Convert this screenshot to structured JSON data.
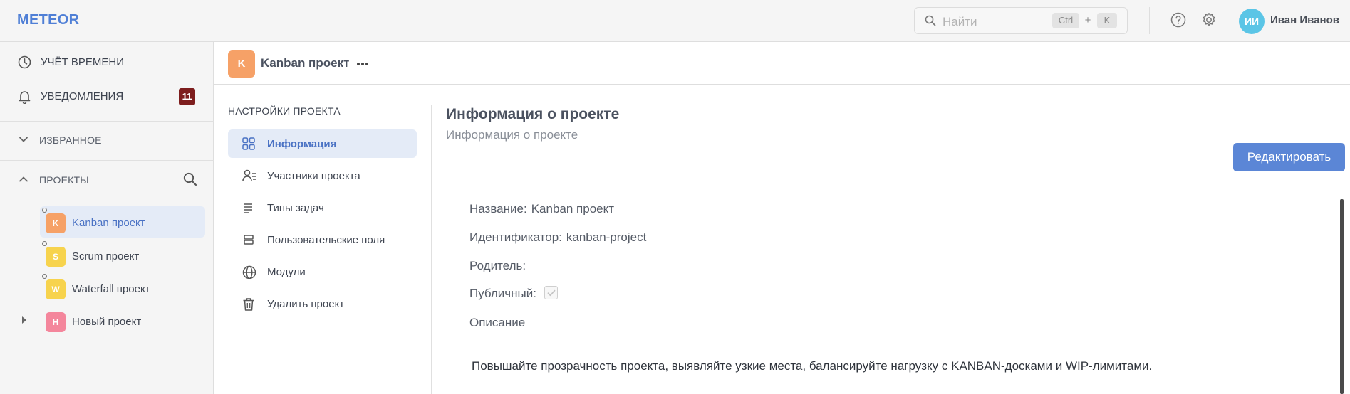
{
  "app": {
    "logo": "METEOR"
  },
  "search": {
    "placeholder": "Найти",
    "shortcut_ctrl": "Ctrl",
    "shortcut_plus": "+",
    "shortcut_key": "K"
  },
  "user": {
    "initials": "ИИ",
    "name": "Иван Иванов",
    "avatar_color": "#5bc5e6"
  },
  "sidebar": {
    "time_tracking": "УЧЁТ ВРЕМЕНИ",
    "notifications": "УВЕДОМЛЕНИЯ",
    "notifications_count": "11",
    "favorites": "ИЗБРАННОЕ",
    "projects": "ПРОЕКТЫ",
    "project_list": [
      {
        "initial": "K",
        "name": "Kanban проект",
        "color": "#f6a167",
        "active": true
      },
      {
        "initial": "S",
        "name": "Scrum проект",
        "color": "#f7d34d",
        "active": false
      },
      {
        "initial": "W",
        "name": "Waterfall проект",
        "color": "#f7d34d",
        "active": false
      },
      {
        "initial": "Н",
        "name": "Новый проект",
        "color": "#f4869c",
        "active": false
      }
    ]
  },
  "header": {
    "initial": "K",
    "title": "Kanban проект"
  },
  "settings_nav": {
    "title": "НАСТРОЙКИ ПРОЕКТА",
    "items": [
      {
        "label": "Информация",
        "icon": "grid-icon",
        "active": true
      },
      {
        "label": "Участники проекта",
        "icon": "members-icon",
        "active": false
      },
      {
        "label": "Типы задач",
        "icon": "list-icon",
        "active": false
      },
      {
        "label": "Пользовательские поля",
        "icon": "fields-icon",
        "active": false
      },
      {
        "label": "Модули",
        "icon": "globe-icon",
        "active": false
      },
      {
        "label": "Удалить проект",
        "icon": "trash-icon",
        "active": false
      }
    ]
  },
  "content": {
    "title": "Информация о проекте",
    "subtitle": "Информация о проекте",
    "edit_button": "Редактировать",
    "name_label": "Название:",
    "name_value": "Kanban проект",
    "identifier_label": "Идентификатор:",
    "identifier_value": "kanban-project",
    "parent_label": "Родитель:",
    "public_label": "Публичный:",
    "public_checked": true,
    "description_label": "Описание",
    "description_text": "Повышайте прозрачность проекта, выявляйте узкие места, балансируйте нагрузку с KANBAN-досками и WIP-лимитами."
  },
  "colors": {
    "accent": "#4f7fd6",
    "button": "#5b86d6",
    "badge": "#7d1d1d",
    "active_bg": "#e4ebf7"
  }
}
